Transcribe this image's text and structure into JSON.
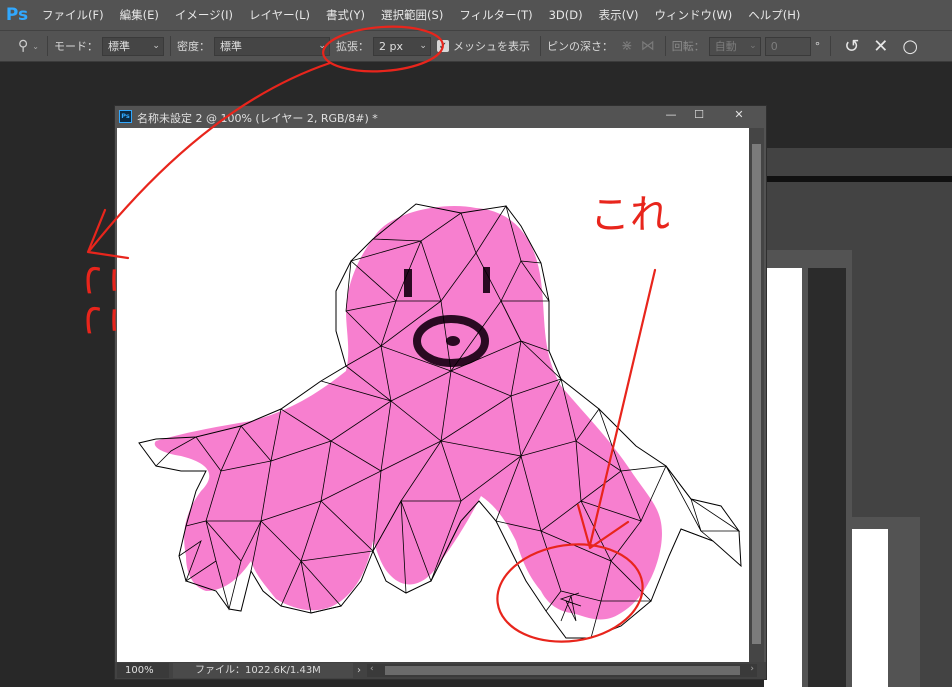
{
  "app": {
    "logo": "Ps"
  },
  "menu": [
    "ファイル(F)",
    "編集(E)",
    "イメージ(I)",
    "レイヤー(L)",
    "書式(Y)",
    "選択範囲(S)",
    "フィルター(T)",
    "3D(D)",
    "表示(V)",
    "ウィンドウ(W)",
    "ヘルプ(H)"
  ],
  "options": {
    "mode_label": "モード：",
    "mode_value": "標準",
    "density_label": "密度：",
    "density_value": "標準",
    "expand_label": "拡張：",
    "expand_value": "2 px",
    "show_mesh_label": "メッシュを表示",
    "show_mesh_checked": true,
    "pin_depth_label": "ピンの深さ：",
    "rotate_label": "回転：",
    "rotate_value": "自動",
    "angle_value": "0",
    "degree_symbol": "°"
  },
  "document": {
    "title": "名称未設定 2 @ 100% (レイヤー 2, RGB/8#) *",
    "zoom": "100%",
    "file_info": "ファイル：1022.6K/1.43M",
    "minimize": "—",
    "maximize": "☐",
    "close": "✕"
  },
  "annotations": {
    "handwritten_left": "ここ",
    "handwritten_right": "これ",
    "colors": {
      "ink": "#e8251c",
      "octopus": "#f77fcf"
    }
  }
}
